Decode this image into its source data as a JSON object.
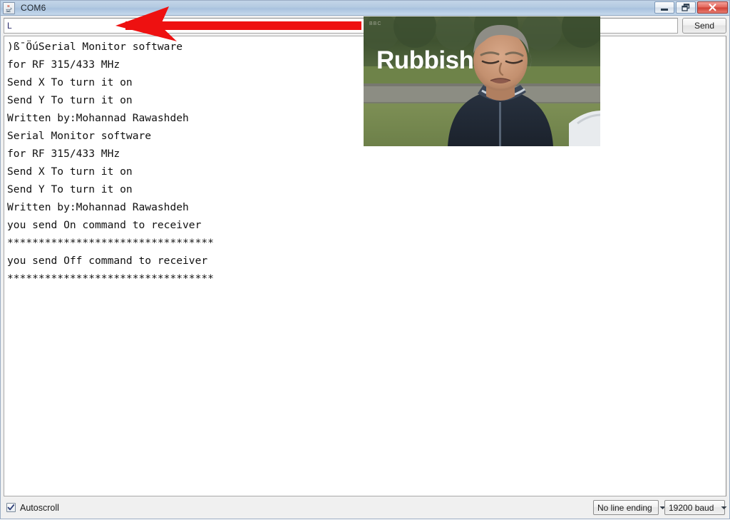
{
  "window": {
    "title": "COM6",
    "app_icon": "java-coffee-cup-icon",
    "controls": {
      "minimize": "minimize-button",
      "restore": "restore-button",
      "close": "close-button"
    }
  },
  "send_row": {
    "input_value": "L",
    "input_placeholder": "",
    "send_label": "Send"
  },
  "console": {
    "lines": [
      ")ß¯ÖúSerial Monitor software",
      "for RF 315/433 MHz",
      "Send X To turn it on",
      "Send Y To turn it on",
      "Written by:Mohannad Rawashdeh",
      "Serial Monitor software",
      "for RF 315/433 MHz",
      "Send X To turn it on",
      "Send Y To turn it on",
      "Written by:Mohannad Rawashdeh",
      "you send On command to receiver",
      "*********************************",
      "you send Off command to receiver",
      "*********************************"
    ]
  },
  "statusbar": {
    "autoscroll_label": "Autoscroll",
    "autoscroll_checked": true,
    "line_ending": "No line ending",
    "baud_rate": "19200 baud"
  },
  "annotations": {
    "arrow_color": "#ee1111",
    "arrow_name": "red-pointer-arrow"
  },
  "meme": {
    "caption": "Rubbish",
    "watermark": "BBC",
    "alt": "man-shaking-head-photo"
  },
  "colors": {
    "titlebar_top": "#c3d5e8",
    "titlebar_bottom": "#c6d9ec",
    "console_bg": "#ffffff",
    "console_text": "#111111",
    "chrome_bg": "#f0f0f0",
    "close_red": "#cf4034",
    "input_text": "#2a2a6a"
  }
}
